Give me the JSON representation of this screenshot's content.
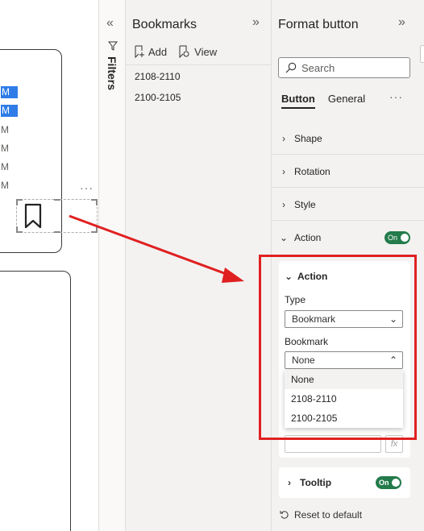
{
  "canvas": {
    "rows": [
      {
        "text": "M",
        "selected": true
      },
      {
        "text": "M",
        "selected": true
      },
      {
        "text": "M",
        "selected": false
      },
      {
        "text": "M",
        "selected": false
      },
      {
        "text": "M",
        "selected": false
      },
      {
        "text": "M",
        "selected": false
      }
    ],
    "more_icon": "more-options-icon",
    "selected_visual_icon": "bookmark-icon"
  },
  "filters": {
    "label": "Filters",
    "collapse_icon": "chevron-double-left-icon"
  },
  "bookmarks": {
    "title": "Bookmarks",
    "expand_icon": "chevron-double-right-icon",
    "add_label": "Add",
    "view_label": "View",
    "items": [
      "2108-2110",
      "2100-2105"
    ]
  },
  "format": {
    "title": "Format button",
    "search_placeholder": "Search",
    "tabs": [
      "Button",
      "General"
    ],
    "active_tab": "Button",
    "sections": [
      "Shape",
      "Rotation",
      "Style",
      "Action"
    ],
    "action_toggle": "On",
    "action_card": {
      "header": "Action",
      "type_label": "Type",
      "type_value": "Bookmark",
      "bookmark_label": "Bookmark",
      "bookmark_value": "None",
      "options": [
        "None",
        "2108-2110",
        "2100-2105"
      ]
    },
    "tooltip_label": "Tooltip",
    "tooltip_toggle": "On",
    "reset_label": "Reset to default"
  },
  "colors": {
    "accent_toggle": "#237b4b",
    "selection_blue": "#2f7ce8",
    "annotation_red": "#e02020"
  }
}
